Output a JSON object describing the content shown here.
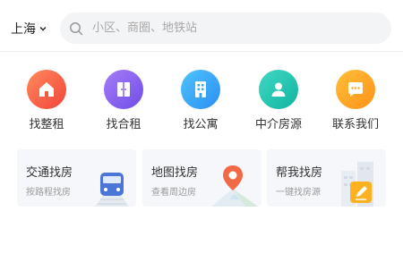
{
  "header": {
    "city": "上海",
    "search_placeholder": "小区、商圈、地铁站"
  },
  "categories": [
    {
      "label": "找整租",
      "icon": "house-icon",
      "color": "#f45c3c"
    },
    {
      "label": "找合租",
      "icon": "door-icon",
      "color": "#8a63f0"
    },
    {
      "label": "找公寓",
      "icon": "building-icon",
      "color": "#33a8f5"
    },
    {
      "label": "中介房源",
      "icon": "agent-icon",
      "color": "#1fc6b2"
    },
    {
      "label": "联系我们",
      "icon": "chat-icon",
      "color": "#ffa21e"
    }
  ],
  "cards": [
    {
      "title": "交通找房",
      "subtitle": "按路程找房",
      "icon": "train-icon"
    },
    {
      "title": "地图找房",
      "subtitle": "查看周边房",
      "icon": "map-pin-icon"
    },
    {
      "title": "帮我找房",
      "subtitle": "一键找房源",
      "icon": "edit-icon"
    }
  ]
}
